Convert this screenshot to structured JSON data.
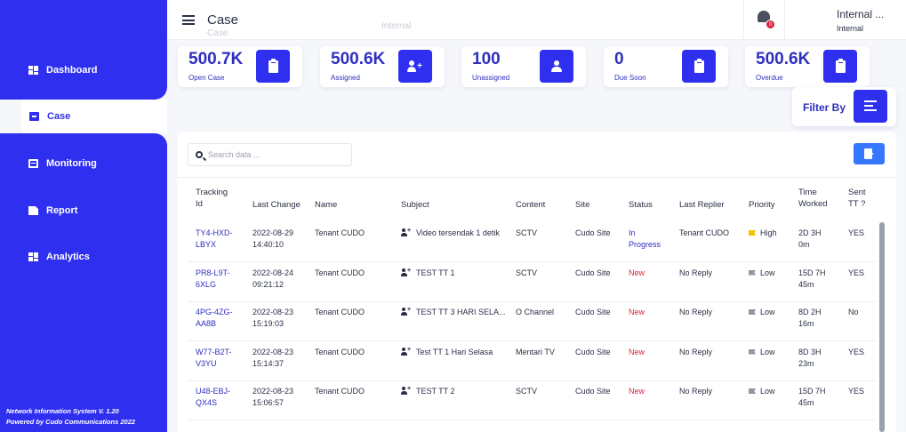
{
  "sidebar": {
    "items": [
      {
        "label": "Dashboard",
        "icon": "dashboard-icon"
      },
      {
        "label": "Case",
        "icon": "case-icon"
      },
      {
        "label": "Monitoring",
        "icon": "monitoring-icon"
      },
      {
        "label": "Report",
        "icon": "report-icon"
      },
      {
        "label": "Analytics",
        "icon": "analytics-icon"
      }
    ],
    "active": "Case",
    "footer_line1": "Network Information System V. 1.20",
    "footer_line2": "Powered by Cudo Communications 2022",
    "color": "#2f2ff0"
  },
  "header": {
    "title": "Case",
    "ghost_title": "Case",
    "ghost_user": "Internal",
    "notification_count": "0",
    "user_name": "Internal ...",
    "user_role": "Internal"
  },
  "stats": [
    {
      "value": "500.7K",
      "label": "Open Case",
      "icon": "clipboard-icon"
    },
    {
      "value": "500.6K",
      "label": "Assigned",
      "icon": "user-plus-icon"
    },
    {
      "value": "100",
      "label": "Unassigned",
      "icon": "user-icon"
    },
    {
      "value": "0",
      "label": "Due Soon",
      "icon": "clipboard-icon"
    },
    {
      "value": "500.6K",
      "label": "Overdue",
      "icon": "clipboard-icon"
    }
  ],
  "filter": {
    "label": "Filter By",
    "icon": "filter-list-icon"
  },
  "search": {
    "placeholder": "Search data ..."
  },
  "table": {
    "headers": {
      "tracking_1": "Tracking",
      "tracking_2": "Id",
      "last_change": "Last Change",
      "name": "Name",
      "subject": "Subject",
      "content": "Content",
      "site": "Site",
      "status": "Status",
      "last_replier": "Last Replier",
      "priority": "Priority",
      "time_1": "Time",
      "time_2": "Worked",
      "sent_1": "Sent",
      "sent_2": "TT ?"
    },
    "rows": [
      {
        "id1": "TY4-HXD-",
        "id2": "LBYX",
        "date": "2022-08-29",
        "time": "14:40:10",
        "name": "Tenant CUDO",
        "subject": "Video tersendak 1 detik",
        "content": "SCTV",
        "site": "Cudo Site",
        "status1": "In",
        "status2": "Progress",
        "replier": "Tenant CUDO",
        "priority": "High",
        "tw1": "2D 3H",
        "tw2": "0m",
        "sent": "YES"
      },
      {
        "id1": "PR8-L9T-",
        "id2": "6XLG",
        "date": "2022-08-24",
        "time": "09:21:12",
        "name": "Tenant CUDO",
        "subject": "TEST TT 1",
        "content": "SCTV",
        "site": "Cudo Site",
        "status1": "New",
        "status2": "",
        "replier": "No Reply",
        "priority": "Low",
        "tw1": "15D 7H",
        "tw2": "45m",
        "sent": "YES"
      },
      {
        "id1": "4PG-4ZG-",
        "id2": "AA8B",
        "date": "2022-08-23",
        "time": "15:19:03",
        "name": "Tenant CUDO",
        "subject": "TEST TT 3 HARI SELA...",
        "content": "O Channel",
        "site": "Cudo Site",
        "status1": "New",
        "status2": "",
        "replier": "No Reply",
        "priority": "Low",
        "tw1": "8D 2H",
        "tw2": "16m",
        "sent": "No"
      },
      {
        "id1": "W77-B2T-",
        "id2": "V3YU",
        "date": "2022-08-23",
        "time": "15:14:37",
        "name": "Tenant CUDO",
        "subject": "Test TT 1 Hari Selasa",
        "content": "Mentari TV",
        "site": "Cudo Site",
        "status1": "New",
        "status2": "",
        "replier": "No Reply",
        "priority": "Low",
        "tw1": "8D 3H",
        "tw2": "23m",
        "sent": "YES"
      },
      {
        "id1": "U48-EBJ-",
        "id2": "QX4S",
        "date": "2022-08-23",
        "time": "15:06:57",
        "name": "Tenant CUDO",
        "subject": "TEST TT 2",
        "content": "SCTV",
        "site": "Cudo Site",
        "status1": "New",
        "status2": "",
        "replier": "No Reply",
        "priority": "Low",
        "tw1": "15D 7H",
        "tw2": "45m",
        "sent": "YES"
      }
    ]
  },
  "colors": {
    "brand": "#2f2ff0",
    "status_new": "#d7263d",
    "status_progress": "#2f2fbf",
    "priority_high": "#f2c200",
    "priority_low": "#8e96a8"
  }
}
